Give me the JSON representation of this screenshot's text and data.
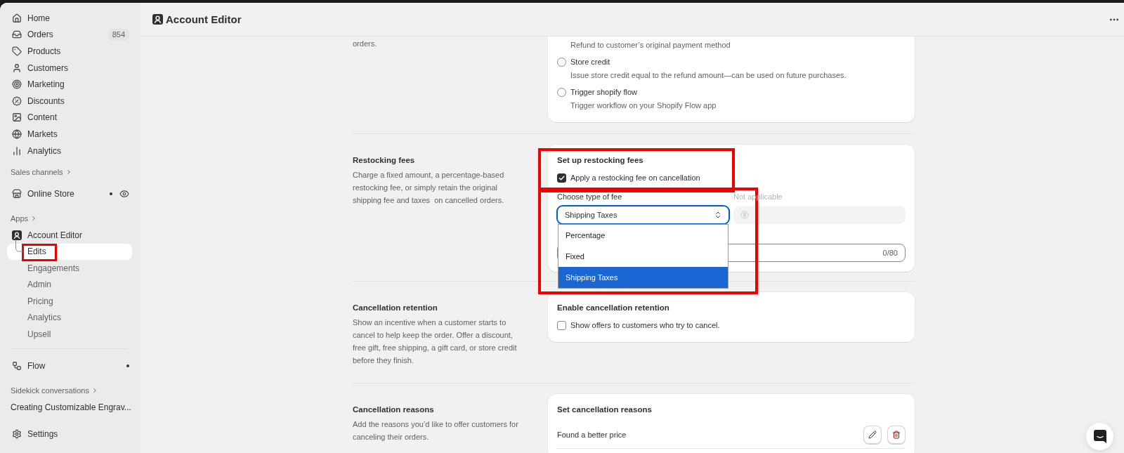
{
  "sidebar": {
    "nav": [
      {
        "label": "Home",
        "selected": false
      },
      {
        "label": "Orders",
        "badge": "854",
        "selected": false
      },
      {
        "label": "Products",
        "selected": false
      },
      {
        "label": "Customers",
        "selected": false
      },
      {
        "label": "Marketing",
        "selected": false
      },
      {
        "label": "Discounts",
        "selected": false
      },
      {
        "label": "Content",
        "selected": false
      },
      {
        "label": "Markets",
        "selected": false
      },
      {
        "label": "Analytics",
        "selected": false
      }
    ],
    "sales_channels": {
      "heading": "Sales channels",
      "items": [
        {
          "label": "Online Store",
          "selected": false,
          "unread": true
        }
      ]
    },
    "apps": {
      "heading": "Apps",
      "items": [
        {
          "label": "Account Editor",
          "selected": false,
          "unread": false,
          "children": [
            {
              "label": "Edits",
              "selected": true,
              "highlighted": true
            },
            {
              "label": "Engagements",
              "selected": false,
              "highlighted": false
            },
            {
              "label": "Admin",
              "selected": false,
              "highlighted": false
            },
            {
              "label": "Pricing",
              "selected": false,
              "highlighted": false
            },
            {
              "label": "Analytics",
              "selected": false,
              "highlighted": false
            },
            {
              "label": "Upsell",
              "selected": false,
              "highlighted": false
            }
          ]
        },
        {
          "label": "Flow",
          "selected": false,
          "unread": true
        }
      ]
    },
    "sidekick": {
      "heading": "Sidekick conversations",
      "items": [
        {
          "label": "Creating Customizable Engrav...",
          "selected": false
        }
      ]
    },
    "settings": {
      "label": "Settings",
      "selected": false
    }
  },
  "header": {
    "title": "Account Editor"
  },
  "sections": [
    {
      "kind": "refund_methods",
      "description": "orders.",
      "options": [
        {
          "description": "Refund to customer’s original payment method"
        },
        {
          "label": "Store credit",
          "selected": false,
          "description": "Issue store credit equal to the refund amount—can be used on future purchases."
        },
        {
          "label": "Trigger shopify flow",
          "selected": false,
          "description": "Trigger workflow on your Shopify Flow app"
        }
      ]
    },
    {
      "kind": "restocking_fees",
      "title": "Restocking fees",
      "description": "Charge a fixed amount, a percentage-based restocking fee, or simply retain the original shipping fee and taxes  on cancelled orders.",
      "card": {
        "heading": "Set up restocking fees",
        "highlighted": true,
        "apply_fee": {
          "label": "Apply a restocking fee on cancellation",
          "checked": true
        },
        "fee_type": {
          "label": "Choose type of fee",
          "value": "Shipping Taxes",
          "expanded": true,
          "highlighted": true,
          "options": [
            {
              "label": "Percentage",
              "selected": false
            },
            {
              "label": "Fixed",
              "selected": false
            },
            {
              "label": "Shipping Taxes",
              "selected": true
            }
          ]
        },
        "amount": {
          "label": "Not applicable",
          "disabled": true
        },
        "note": {
          "counter": "0/80"
        }
      }
    },
    {
      "kind": "retention",
      "title": "Cancellation retention",
      "description": "Show an incentive when a customer starts to cancel to help keep the order. Offer a discount, free gift, free shipping, a gift card, or store credit before they finish.",
      "card": {
        "heading": "Enable cancellation retention",
        "checkbox": {
          "label": "Show offers to customers who try to cancel.",
          "checked": false
        }
      }
    },
    {
      "kind": "reasons",
      "title": "Cancellation reasons",
      "description": "Add the reasons you’d like to offer customers for canceling their orders.",
      "card": {
        "heading": "Set cancellation reasons",
        "reasons": [
          {
            "label": "Found a better price"
          }
        ]
      }
    }
  ]
}
